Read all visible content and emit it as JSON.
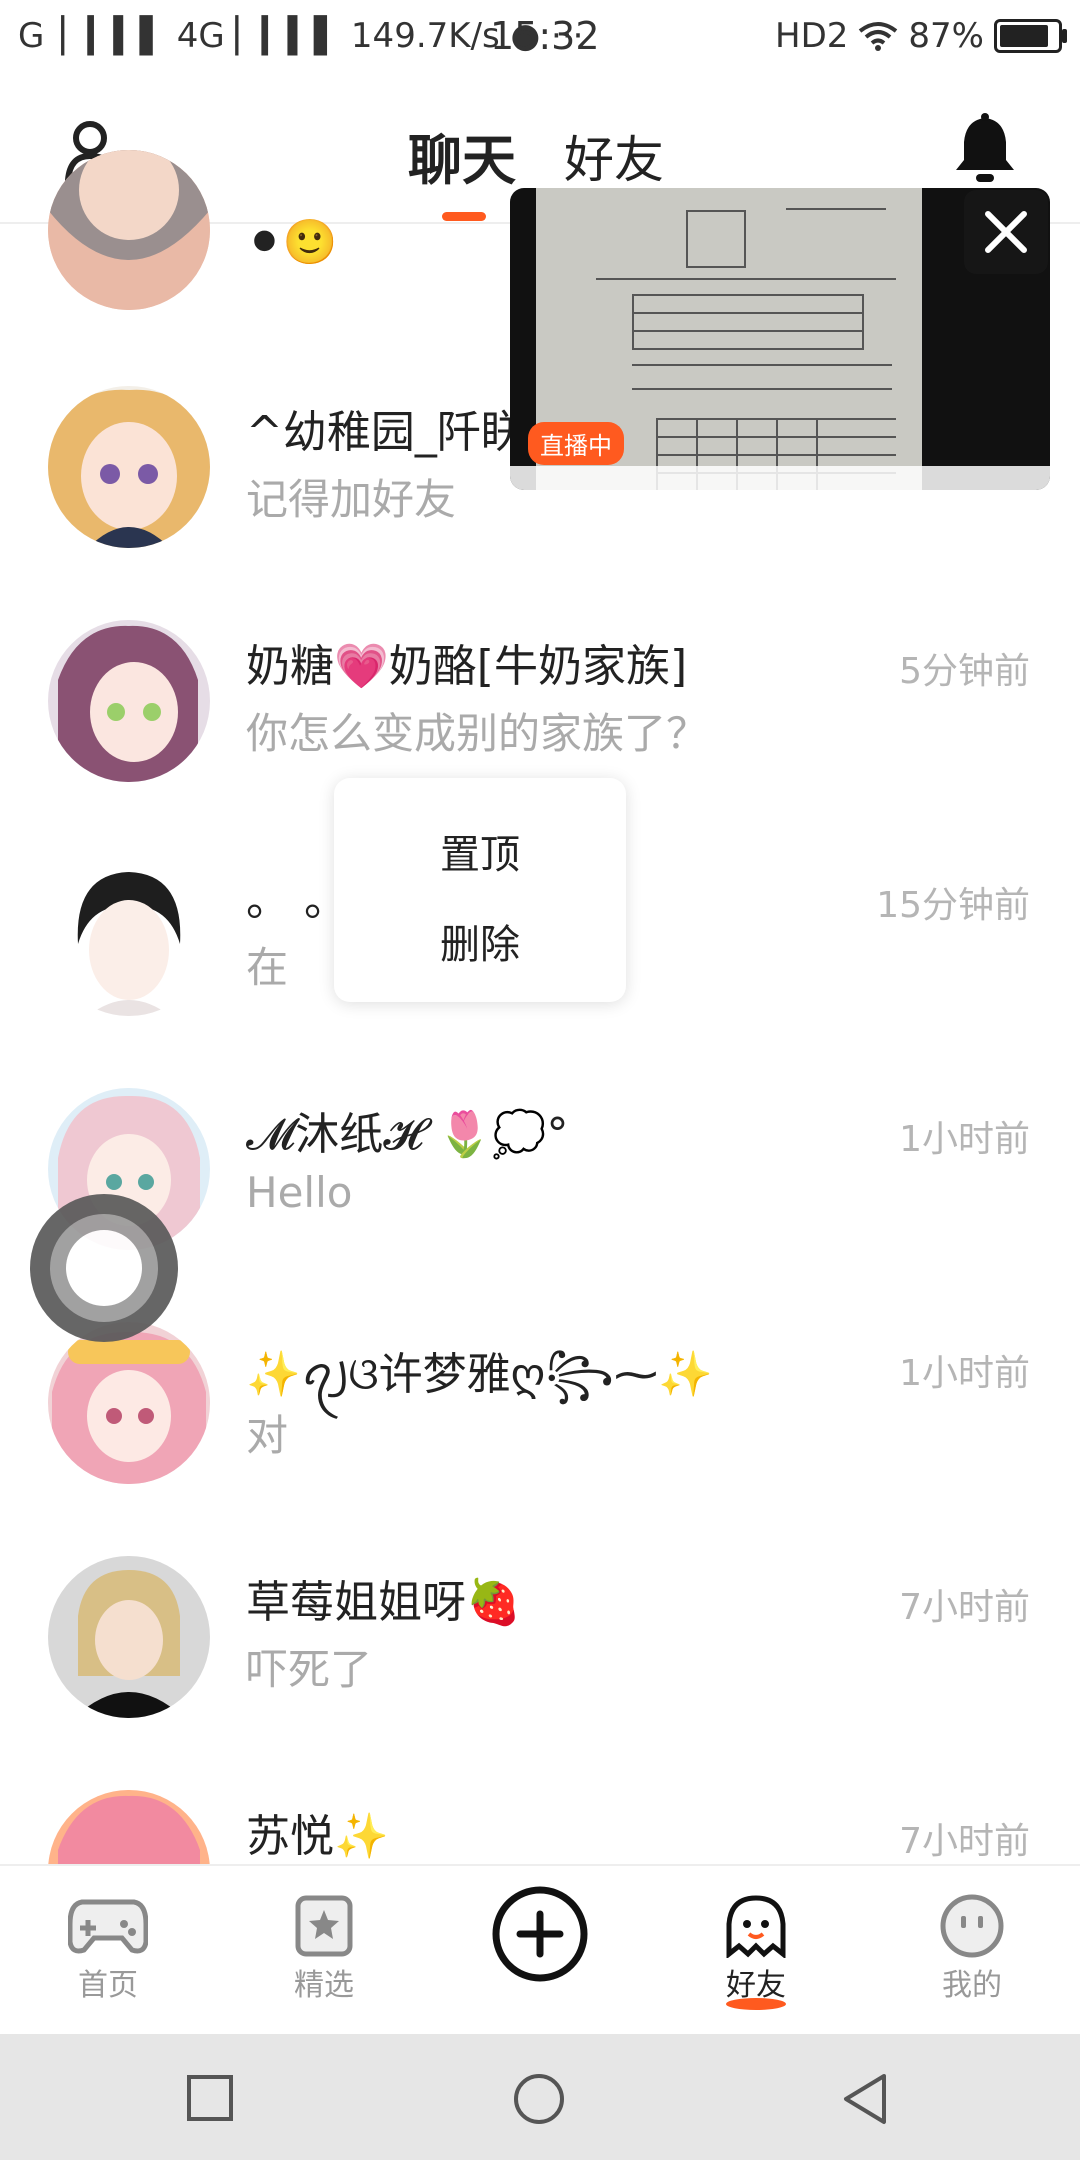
{
  "status_bar": {
    "left": "G ▏▎▍▌ 4G ▏▎▍▌ 149.7K/s",
    "time": "15:32",
    "right_hd": "HD2",
    "battery": "87%",
    "battery_level": 0.87
  },
  "header": {
    "tab_chat": "聊天",
    "tab_friends": "好友"
  },
  "live_video": {
    "badge": "直播中"
  },
  "context_menu": {
    "pin": "置顶",
    "delete": "删除"
  },
  "chats": [
    {
      "name": "⚫🙂",
      "msg": "",
      "time": ""
    },
    {
      "name": "^幼稚园_阡眹",
      "msg": "记得加好友",
      "time": ""
    },
    {
      "name": "奶糖💗奶酪[牛奶家族]",
      "msg": "你怎么变成别的家族了？",
      "time": "5分钟前"
    },
    {
      "name": "。 。",
      "msg": "在",
      "time": "15分钟前"
    },
    {
      "name": "𝓜沐纸𝓗 🌷💭°",
      "msg": "Hello",
      "time": "1小时前"
    },
    {
      "name": "✨ꪖ꠸ଓ许梦雅ღ꧂⁓✨",
      "msg": "对",
      "time": "1小时前"
    },
    {
      "name": "草莓姐姐呀🍓",
      "msg": "吓死了",
      "time": "7小时前"
    },
    {
      "name": "苏悦✨",
      "msg": "",
      "time": "7小时前"
    }
  ],
  "bottom_nav": [
    {
      "label": "首页",
      "icon": "gamepad-icon"
    },
    {
      "label": "精选",
      "icon": "star-bookmark-icon"
    },
    {
      "label": "",
      "icon": "plus-circle-icon"
    },
    {
      "label": "好友",
      "icon": "ghost-icon"
    },
    {
      "label": "我的",
      "icon": "smiley-icon"
    }
  ],
  "colors": {
    "accent": "#ff5a1f",
    "muted": "#aaaaaa"
  }
}
